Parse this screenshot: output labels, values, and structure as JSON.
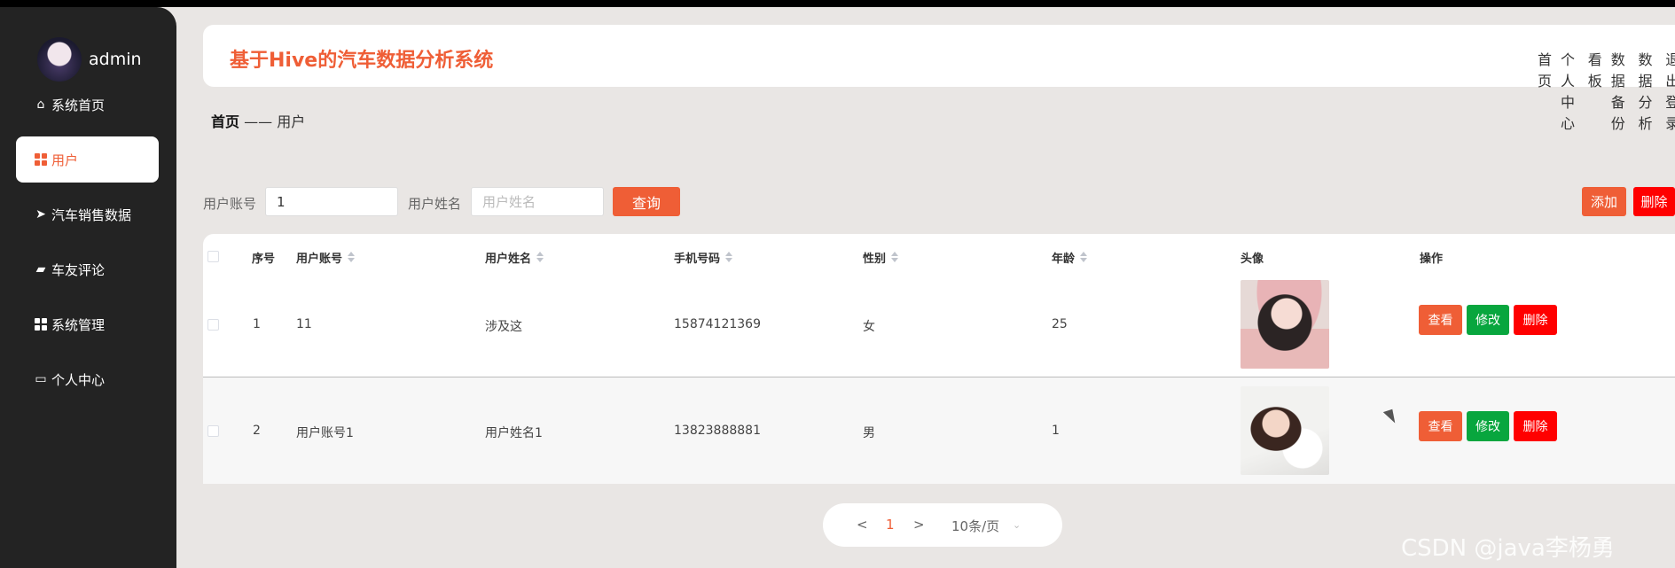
{
  "sidebar": {
    "username": "admin",
    "items": [
      {
        "label": "系统首页",
        "icon": "home-icon"
      },
      {
        "label": "用户",
        "icon": "grid-icon"
      },
      {
        "label": "汽车销售数据",
        "icon": "paper-plane-icon"
      },
      {
        "label": "车友评论",
        "icon": "briefcase-icon"
      },
      {
        "label": "系统管理",
        "icon": "grid-icon"
      },
      {
        "label": "个人中心",
        "icon": "wallet-icon"
      }
    ],
    "active_index": 1
  },
  "header": {
    "title": "基于Hive的汽车数据分析系统",
    "nav": [
      "首页",
      "个人中心",
      "看板",
      "数据备份",
      "数据分析",
      "退出登录"
    ]
  },
  "breadcrumb": {
    "home": "首页",
    "separator": "——",
    "current": "用户"
  },
  "search": {
    "account_label": "用户账号",
    "account_value": "1",
    "name_label": "用户姓名",
    "name_placeholder": "用户姓名",
    "query_button": "查询",
    "add_button": "添加",
    "delete_button": "删除"
  },
  "table": {
    "columns": [
      "序号",
      "用户账号",
      "用户姓名",
      "手机号码",
      "性别",
      "年龄",
      "头像",
      "操作"
    ],
    "rows": [
      {
        "index": "1",
        "account": "11",
        "name": "涉及这",
        "phone": "15874121369",
        "gender": "女",
        "age": "25"
      },
      {
        "index": "2",
        "account": "用户账号1",
        "name": "用户姓名1",
        "phone": "13823888881",
        "gender": "男",
        "age": "1"
      }
    ],
    "actions": {
      "view": "查看",
      "edit": "修改",
      "delete": "删除"
    }
  },
  "pagination": {
    "prev": "<",
    "page": "1",
    "next": ">",
    "page_size": "10条/页"
  },
  "watermark": "CSDN @java李杨勇",
  "colors": {
    "accent": "#ef5e36",
    "danger": "#ff0000",
    "success": "#08a63e",
    "sidebar": "#232323"
  }
}
